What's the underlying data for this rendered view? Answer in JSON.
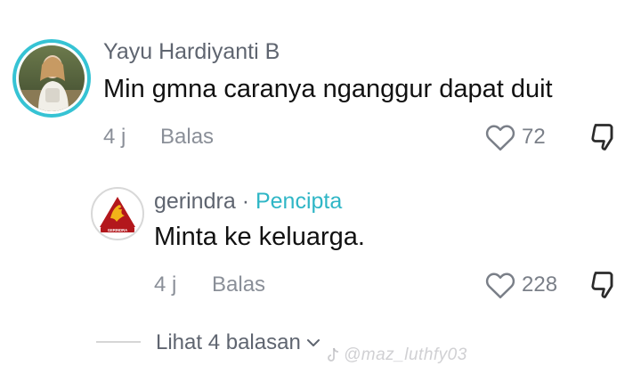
{
  "comment": {
    "username": "Yayu Hardiyanti B",
    "text": "Min gmna caranya nganggur dapat duit",
    "time": "4 j",
    "reply_label": "Balas",
    "like_count": "72"
  },
  "reply": {
    "username": "gerindra",
    "separator": "·",
    "creator_badge": "Pencipta",
    "text": "Minta ke keluarga.",
    "time": "4 j",
    "reply_label": "Balas",
    "like_count": "228",
    "avatar_logo_text": "GERINDRA"
  },
  "view_replies": {
    "label": "Lihat 4 balasan"
  },
  "watermark": {
    "text": "@maz_luthfy03"
  },
  "colors": {
    "avatar_ring": "#36c3d4",
    "creator_badge": "#2fb6c6",
    "gerindra_red": "#b3171c",
    "gerindra_gold": "#f2b419"
  },
  "icons": [
    "heart-outline-icon",
    "thumbs-down-icon",
    "chevron-down-icon",
    "tiktok-logo-icon"
  ]
}
